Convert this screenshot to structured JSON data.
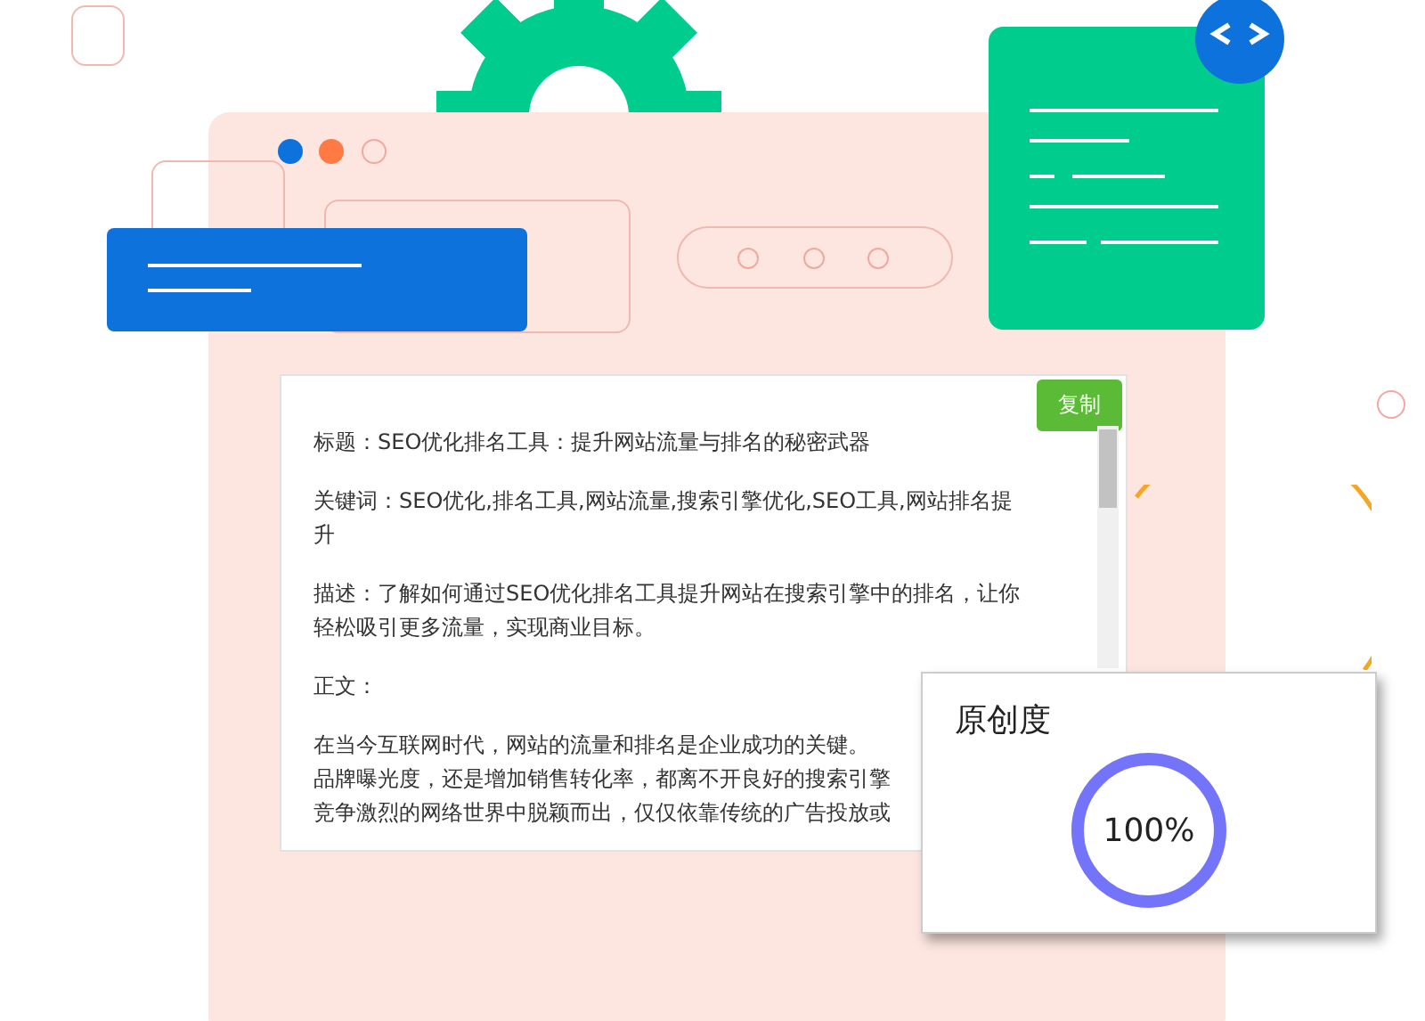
{
  "copy_button": {
    "label": "复制"
  },
  "article": {
    "paragraphs": [
      {
        "lines": [
          "标题：SEO优化排名工具：提升网站流量与排名的秘密武器"
        ]
      },
      {
        "lines": [
          "关键词：SEO优化,排名工具,网站流量,搜索引擎优化,SEO工具,网站排名提",
          "升"
        ]
      },
      {
        "lines": [
          "描述：了解如何通过SEO优化排名工具提升网站在搜索引擎中的排名，让你",
          "轻松吸引更多流量，实现商业目标。"
        ]
      },
      {
        "lines": [
          "正文："
        ]
      },
      {
        "lines": [
          "在当今互联网时代，网站的流量和排名是企业成功的关键。",
          "品牌曝光度，还是增加销售转化率，都离不开良好的搜索引擎",
          "竞争激烈的网络世界中脱颖而出，仅仅依靠传统的广告投放或"
        ]
      }
    ]
  },
  "originality": {
    "title": "原创度",
    "value": "100%",
    "level": 1
  }
}
